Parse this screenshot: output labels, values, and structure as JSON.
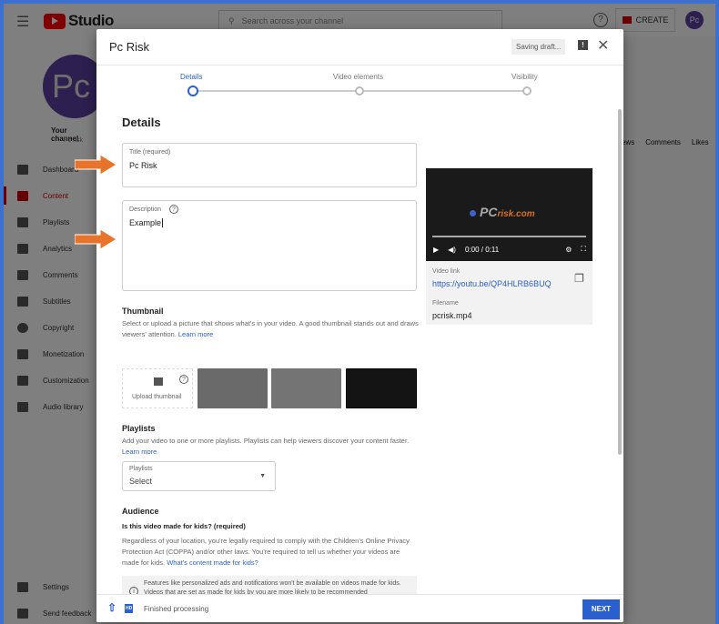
{
  "topbar": {
    "app_name": "Studio",
    "search_placeholder": "Search across your channel",
    "help": "?",
    "create_label": "CREATE",
    "avatar": "Pc"
  },
  "sidebar": {
    "avatar": "Pc",
    "channel_label": "Your channel",
    "channel_name": "Pc risk",
    "items": [
      {
        "label": "Dashboard"
      },
      {
        "label": "Content",
        "active": true
      },
      {
        "label": "Playlists"
      },
      {
        "label": "Analytics"
      },
      {
        "label": "Comments"
      },
      {
        "label": "Subtitles"
      },
      {
        "label": "Copyright"
      },
      {
        "label": "Monetization"
      },
      {
        "label": "Customization"
      },
      {
        "label": "Audio library"
      }
    ],
    "bottom": [
      {
        "label": "Settings"
      },
      {
        "label": "Send feedback"
      }
    ]
  },
  "background": {
    "columns": [
      "Views",
      "Comments",
      "Likes"
    ]
  },
  "dialog": {
    "title": "Pc Risk",
    "status": "Saving draft...",
    "steps": [
      {
        "label": "Details",
        "active": true
      },
      {
        "label": "Video elements"
      },
      {
        "label": "Visibility"
      }
    ],
    "details_heading": "Details",
    "title_field": {
      "label": "Title (required)",
      "value": "Pc Risk"
    },
    "description_field": {
      "label": "Description",
      "value": "Example"
    },
    "video": {
      "logo_text": "PC",
      "logo_suffix": "risk.com",
      "time": "0:00 / 0:11",
      "link_label": "Video link",
      "link": "https://youtu.be/QP4HLRB6BUQ",
      "filename_label": "Filename",
      "filename": "pcrisk.mp4"
    },
    "thumbnail": {
      "heading": "Thumbnail",
      "desc": "Select or upload a picture that shows what's in your video. A good thumbnail stands out and draws viewers' attention.",
      "learn_more": "Learn more",
      "upload_label": "Upload thumbnail"
    },
    "playlists": {
      "heading": "Playlists",
      "desc": "Add your video to one or more playlists. Playlists can help viewers discover your content faster.",
      "learn_more": "Learn more",
      "select_label": "Playlists",
      "select_value": "Select"
    },
    "audience": {
      "heading": "Audience",
      "question": "Is this video made for kids? (required)",
      "desc": "Regardless of your location, you're legally required to comply with the Children's Online Privacy Protection Act (COPPA) and/or other laws. You're required to tell us whether your videos are made for kids.",
      "link": "What's content made for kids?",
      "info": "Features like personalized ads and notifications won't be available on videos made for kids. Videos that are set as made for kids by you are more likely to be recommended"
    },
    "footer": {
      "hd": "HD",
      "status": "Finished processing",
      "next_label": "NEXT"
    }
  },
  "colors": {
    "accent": "#2a5fcf",
    "youtube_red": "#ff0000",
    "arrow": "#e8732a"
  }
}
